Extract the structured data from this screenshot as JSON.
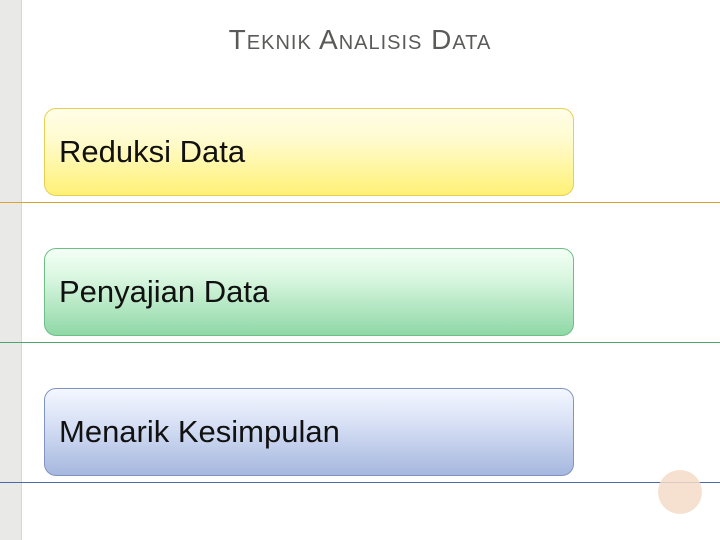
{
  "title": "Teknik Analisis Data",
  "items": [
    {
      "label": "Reduksi Data"
    },
    {
      "label": "Penyajian Data"
    },
    {
      "label": "Menarik Kesimpulan"
    }
  ]
}
